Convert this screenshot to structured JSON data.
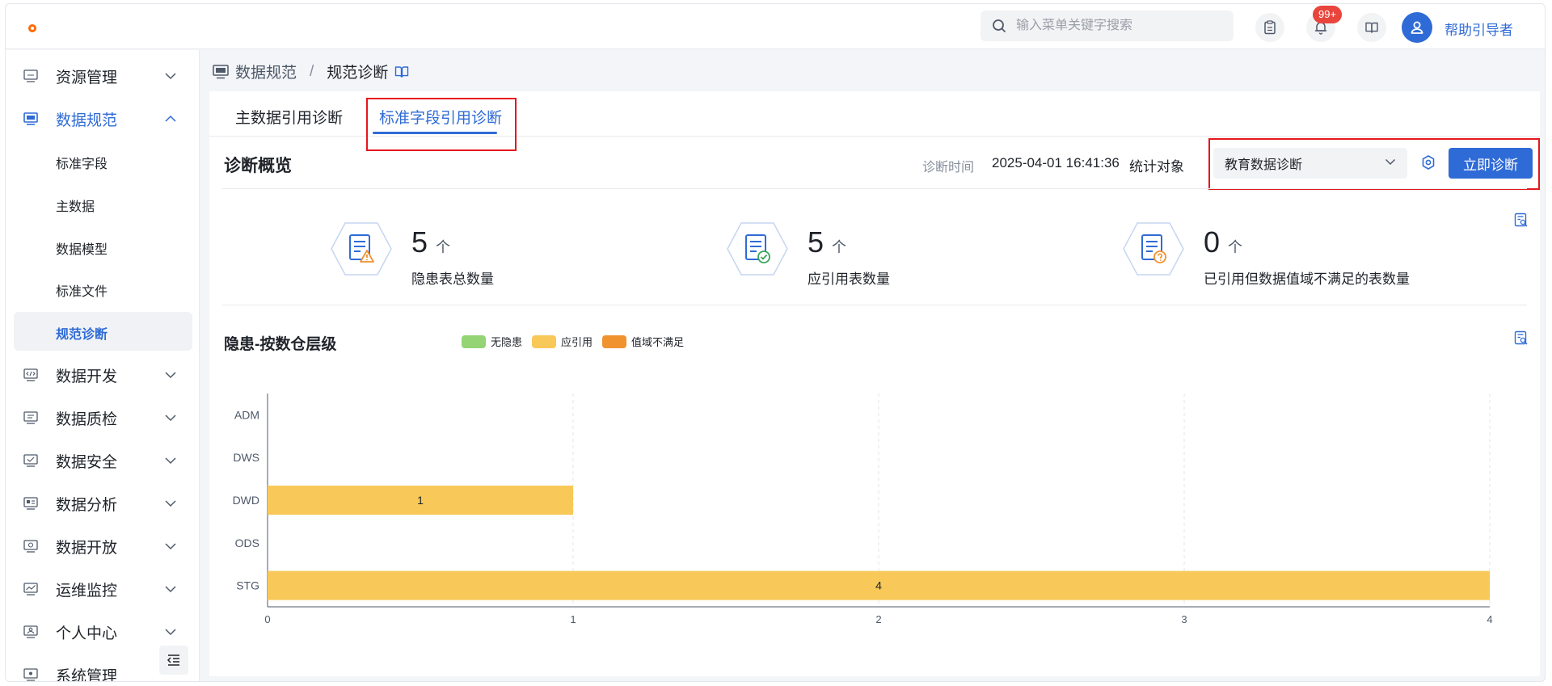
{
  "header": {
    "search_placeholder": "输入菜单关键字搜索",
    "notification_badge": "99+",
    "username": "帮助引导者"
  },
  "sidebar": {
    "items": [
      {
        "label": "资源管理",
        "icon": "server-icon",
        "expanded": false
      },
      {
        "label": "数据规范",
        "icon": "monitor-icon",
        "expanded": true
      },
      {
        "label": "数据开发",
        "icon": "code-icon",
        "expanded": false
      },
      {
        "label": "数据质检",
        "icon": "doc-check-icon",
        "expanded": false
      },
      {
        "label": "数据安全",
        "icon": "shield-icon",
        "expanded": false
      },
      {
        "label": "数据分析",
        "icon": "analysis-icon",
        "expanded": false
      },
      {
        "label": "数据开放",
        "icon": "open-icon",
        "expanded": false
      },
      {
        "label": "运维监控",
        "icon": "line-chart-icon",
        "expanded": false
      },
      {
        "label": "个人中心",
        "icon": "user-card-icon",
        "expanded": false
      },
      {
        "label": "系统管理",
        "icon": "settings-icon",
        "expanded": false
      }
    ],
    "sub_items": [
      "标准字段",
      "主数据",
      "数据模型",
      "标准文件",
      "规范诊断"
    ],
    "active_sub": "规范诊断"
  },
  "breadcrumb": {
    "parent": "数据规范",
    "separator": "/",
    "current": "规范诊断"
  },
  "tabs": [
    {
      "label": "主数据引用诊断",
      "active": false
    },
    {
      "label": "标准字段引用诊断",
      "active": true
    }
  ],
  "overview": {
    "title": "诊断概览",
    "time_label": "诊断时间",
    "time_value": "2025-04-01 16:41:36",
    "target_label": "统计对象",
    "target_value": "教育数据诊断",
    "diagnose_button": "立即诊断"
  },
  "stats": [
    {
      "value": "5",
      "unit": "个",
      "label": "隐患表总数量",
      "icon": "doc-warning-icon"
    },
    {
      "value": "5",
      "unit": "个",
      "label": "应引用表数量",
      "icon": "doc-check-icon"
    },
    {
      "value": "0",
      "unit": "个",
      "label": "已引用但数据值域不满足的表数量",
      "icon": "doc-question-icon"
    }
  ],
  "chart_section": {
    "title": "隐患-按数仓层级",
    "legend": [
      {
        "name": "无隐患",
        "color": "#95d475"
      },
      {
        "name": "应引用",
        "color": "#f8c858"
      },
      {
        "name": "值域不满足",
        "color": "#f0922e"
      }
    ]
  },
  "chart_data": {
    "type": "bar",
    "orientation": "horizontal",
    "stacked": true,
    "categories": [
      "ADM",
      "DWS",
      "DWD",
      "ODS",
      "STG"
    ],
    "series": [
      {
        "name": "无隐患",
        "values": [
          0,
          0,
          0,
          0,
          0
        ],
        "color": "#95d475"
      },
      {
        "name": "应引用",
        "values": [
          0,
          0,
          1,
          0,
          4
        ],
        "color": "#f8c858"
      },
      {
        "name": "值域不满足",
        "values": [
          0,
          0,
          0,
          0,
          0
        ],
        "color": "#f0922e"
      }
    ],
    "xticks": [
      "0",
      "1",
      "2",
      "3",
      "4"
    ],
    "xlim": [
      0,
      4
    ],
    "grid": "vertical-dashed",
    "bar_labels": true
  }
}
